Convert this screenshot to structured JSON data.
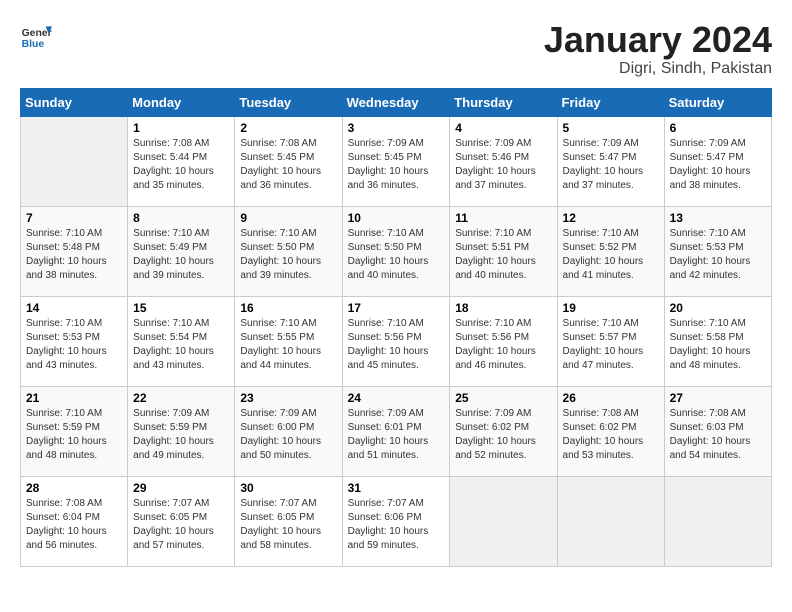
{
  "header": {
    "logo_general": "General",
    "logo_blue": "Blue",
    "title": "January 2024",
    "subtitle": "Digri, Sindh, Pakistan"
  },
  "days_of_week": [
    "Sunday",
    "Monday",
    "Tuesday",
    "Wednesday",
    "Thursday",
    "Friday",
    "Saturday"
  ],
  "weeks": [
    [
      {
        "day": "",
        "empty": true
      },
      {
        "day": "1",
        "sunrise": "7:08 AM",
        "sunset": "5:44 PM",
        "daylight": "10 hours and 35 minutes."
      },
      {
        "day": "2",
        "sunrise": "7:08 AM",
        "sunset": "5:45 PM",
        "daylight": "10 hours and 36 minutes."
      },
      {
        "day": "3",
        "sunrise": "7:09 AM",
        "sunset": "5:45 PM",
        "daylight": "10 hours and 36 minutes."
      },
      {
        "day": "4",
        "sunrise": "7:09 AM",
        "sunset": "5:46 PM",
        "daylight": "10 hours and 37 minutes."
      },
      {
        "day": "5",
        "sunrise": "7:09 AM",
        "sunset": "5:47 PM",
        "daylight": "10 hours and 37 minutes."
      },
      {
        "day": "6",
        "sunrise": "7:09 AM",
        "sunset": "5:47 PM",
        "daylight": "10 hours and 38 minutes."
      }
    ],
    [
      {
        "day": "7",
        "sunrise": "7:10 AM",
        "sunset": "5:48 PM",
        "daylight": "10 hours and 38 minutes."
      },
      {
        "day": "8",
        "sunrise": "7:10 AM",
        "sunset": "5:49 PM",
        "daylight": "10 hours and 39 minutes."
      },
      {
        "day": "9",
        "sunrise": "7:10 AM",
        "sunset": "5:50 PM",
        "daylight": "10 hours and 39 minutes."
      },
      {
        "day": "10",
        "sunrise": "7:10 AM",
        "sunset": "5:50 PM",
        "daylight": "10 hours and 40 minutes."
      },
      {
        "day": "11",
        "sunrise": "7:10 AM",
        "sunset": "5:51 PM",
        "daylight": "10 hours and 40 minutes."
      },
      {
        "day": "12",
        "sunrise": "7:10 AM",
        "sunset": "5:52 PM",
        "daylight": "10 hours and 41 minutes."
      },
      {
        "day": "13",
        "sunrise": "7:10 AM",
        "sunset": "5:53 PM",
        "daylight": "10 hours and 42 minutes."
      }
    ],
    [
      {
        "day": "14",
        "sunrise": "7:10 AM",
        "sunset": "5:53 PM",
        "daylight": "10 hours and 43 minutes."
      },
      {
        "day": "15",
        "sunrise": "7:10 AM",
        "sunset": "5:54 PM",
        "daylight": "10 hours and 43 minutes."
      },
      {
        "day": "16",
        "sunrise": "7:10 AM",
        "sunset": "5:55 PM",
        "daylight": "10 hours and 44 minutes."
      },
      {
        "day": "17",
        "sunrise": "7:10 AM",
        "sunset": "5:56 PM",
        "daylight": "10 hours and 45 minutes."
      },
      {
        "day": "18",
        "sunrise": "7:10 AM",
        "sunset": "5:56 PM",
        "daylight": "10 hours and 46 minutes."
      },
      {
        "day": "19",
        "sunrise": "7:10 AM",
        "sunset": "5:57 PM",
        "daylight": "10 hours and 47 minutes."
      },
      {
        "day": "20",
        "sunrise": "7:10 AM",
        "sunset": "5:58 PM",
        "daylight": "10 hours and 48 minutes."
      }
    ],
    [
      {
        "day": "21",
        "sunrise": "7:10 AM",
        "sunset": "5:59 PM",
        "daylight": "10 hours and 48 minutes."
      },
      {
        "day": "22",
        "sunrise": "7:09 AM",
        "sunset": "5:59 PM",
        "daylight": "10 hours and 49 minutes."
      },
      {
        "day": "23",
        "sunrise": "7:09 AM",
        "sunset": "6:00 PM",
        "daylight": "10 hours and 50 minutes."
      },
      {
        "day": "24",
        "sunrise": "7:09 AM",
        "sunset": "6:01 PM",
        "daylight": "10 hours and 51 minutes."
      },
      {
        "day": "25",
        "sunrise": "7:09 AM",
        "sunset": "6:02 PM",
        "daylight": "10 hours and 52 minutes."
      },
      {
        "day": "26",
        "sunrise": "7:08 AM",
        "sunset": "6:02 PM",
        "daylight": "10 hours and 53 minutes."
      },
      {
        "day": "27",
        "sunrise": "7:08 AM",
        "sunset": "6:03 PM",
        "daylight": "10 hours and 54 minutes."
      }
    ],
    [
      {
        "day": "28",
        "sunrise": "7:08 AM",
        "sunset": "6:04 PM",
        "daylight": "10 hours and 56 minutes."
      },
      {
        "day": "29",
        "sunrise": "7:07 AM",
        "sunset": "6:05 PM",
        "daylight": "10 hours and 57 minutes."
      },
      {
        "day": "30",
        "sunrise": "7:07 AM",
        "sunset": "6:05 PM",
        "daylight": "10 hours and 58 minutes."
      },
      {
        "day": "31",
        "sunrise": "7:07 AM",
        "sunset": "6:06 PM",
        "daylight": "10 hours and 59 minutes."
      },
      {
        "day": "",
        "empty": true
      },
      {
        "day": "",
        "empty": true
      },
      {
        "day": "",
        "empty": true
      }
    ]
  ]
}
